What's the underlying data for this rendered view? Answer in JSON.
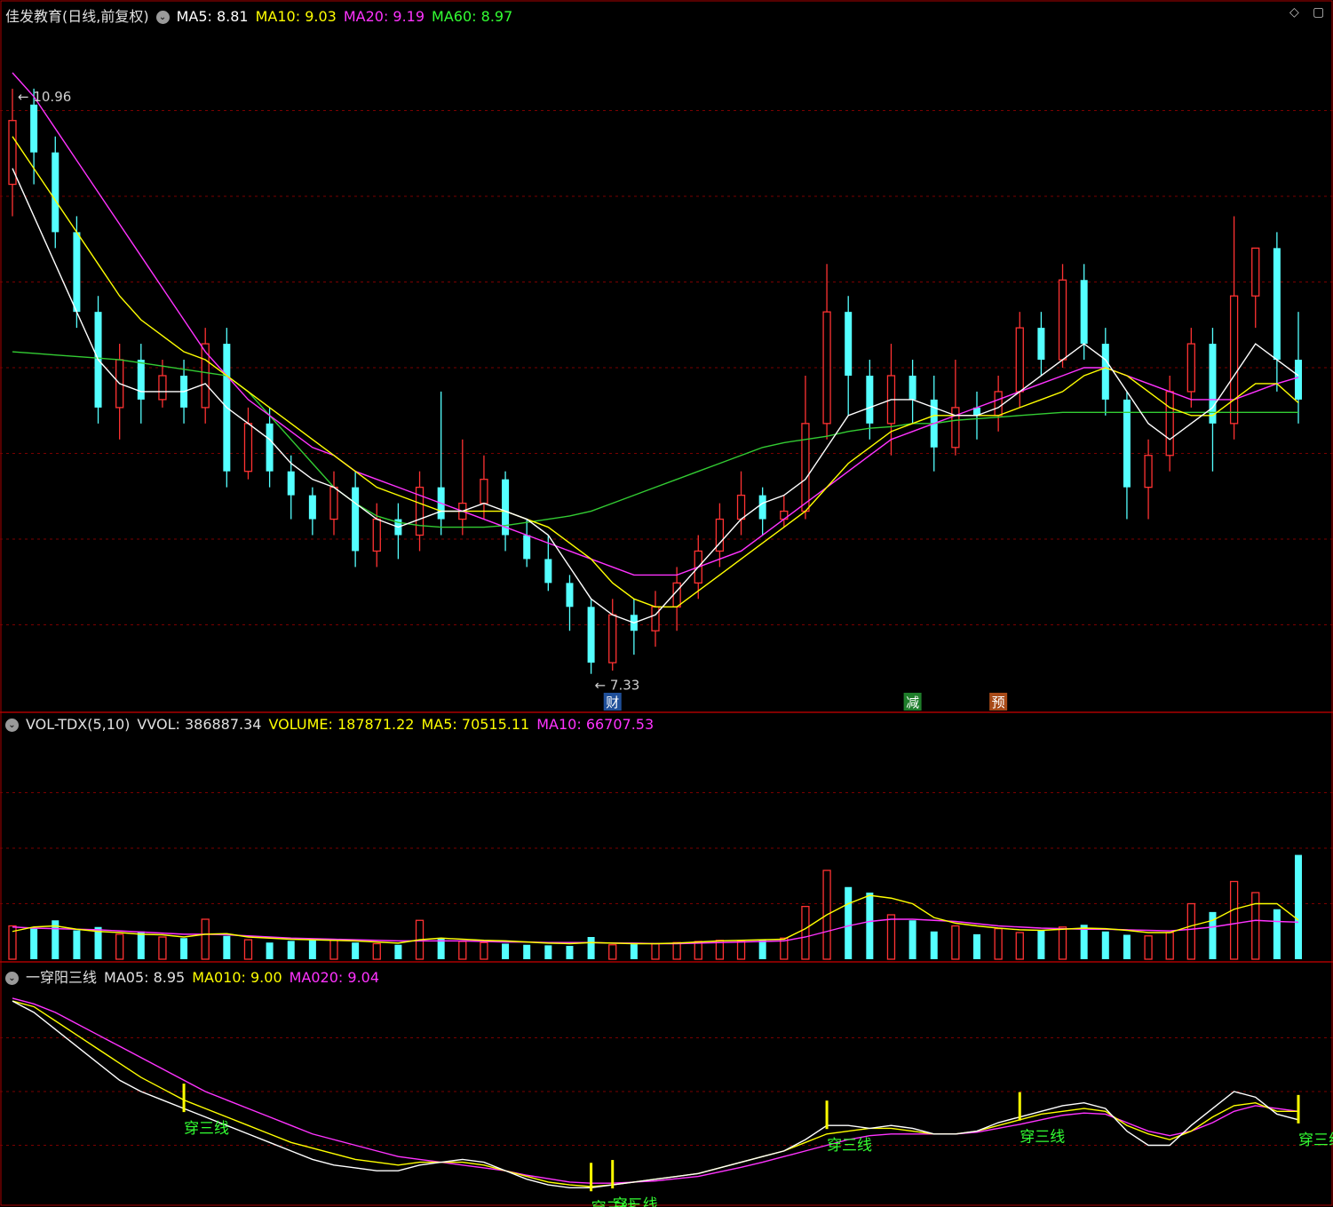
{
  "colors": {
    "up": "#ff3232",
    "down": "#54ffff",
    "ma_white": "#ffffff",
    "ma_yellow": "#ffff00",
    "ma_magenta": "#ff33ff",
    "ma_green": "#33cc33",
    "grid": "#7a0000",
    "frame": "#aa0000",
    "signal": "#ffff00",
    "signal_text": "#33ff33"
  },
  "price_panel": {
    "title": "佳发教育(日线,前复权)",
    "ma5": "MA5: 8.81",
    "ma10": "MA10: 9.03",
    "ma20": "MA20: 9.19",
    "ma60": "MA60: 8.97",
    "high_label": "10.96",
    "low_label": "7.33",
    "events": [
      "财",
      "减",
      "预"
    ]
  },
  "volume_panel": {
    "title": "VOL-TDX(5,10)",
    "vvol": "VVOL: 386887.34",
    "volume": "VOLUME: 187871.22",
    "ma5": "MA5: 70515.11",
    "ma10": "MA10: 66707.53"
  },
  "indicator_panel": {
    "title": "一穿阳三线",
    "ma05": "MA05: 8.95",
    "ma010": "MA010: 9.00",
    "ma020": "MA020: 9.04",
    "signal_label": "穿三线"
  },
  "icons": {
    "window_controls": [
      "diamond-icon",
      "restore-icon"
    ],
    "collapse": "chevron-down-icon"
  },
  "chart_data": {
    "type": "candlestick",
    "y_range": [
      7.1,
      11.4
    ],
    "candles": [
      [
        10.4,
        10.8,
        10.2,
        11.0
      ],
      [
        10.9,
        10.6,
        10.4,
        11.0
      ],
      [
        10.6,
        10.1,
        10.0,
        10.7
      ],
      [
        10.1,
        9.6,
        9.5,
        10.2
      ],
      [
        9.6,
        9.0,
        8.9,
        9.7
      ],
      [
        9.0,
        9.3,
        8.8,
        9.4
      ],
      [
        9.3,
        9.05,
        8.9,
        9.4
      ],
      [
        9.05,
        9.2,
        9.0,
        9.3
      ],
      [
        9.2,
        9.0,
        8.9,
        9.3
      ],
      [
        9.0,
        9.4,
        8.9,
        9.5
      ],
      [
        9.4,
        8.6,
        8.5,
        9.5
      ],
      [
        8.6,
        8.9,
        8.55,
        9.0
      ],
      [
        8.9,
        8.6,
        8.5,
        9.0
      ],
      [
        8.6,
        8.45,
        8.3,
        8.7
      ],
      [
        8.45,
        8.3,
        8.2,
        8.5
      ],
      [
        8.3,
        8.5,
        8.2,
        8.6
      ],
      [
        8.5,
        8.1,
        8.0,
        8.6
      ],
      [
        8.1,
        8.3,
        8.0,
        8.4
      ],
      [
        8.3,
        8.2,
        8.05,
        8.4
      ],
      [
        8.2,
        8.5,
        8.1,
        8.6
      ],
      [
        8.5,
        8.3,
        8.2,
        9.1
      ],
      [
        8.3,
        8.4,
        8.2,
        8.8
      ],
      [
        8.4,
        8.55,
        8.3,
        8.7
      ],
      [
        8.55,
        8.2,
        8.1,
        8.6
      ],
      [
        8.2,
        8.05,
        8.0,
        8.3
      ],
      [
        8.05,
        7.9,
        7.85,
        8.2
      ],
      [
        7.9,
        7.75,
        7.6,
        7.95
      ],
      [
        7.75,
        7.4,
        7.33,
        7.8
      ],
      [
        7.4,
        7.7,
        7.35,
        7.8
      ],
      [
        7.7,
        7.6,
        7.45,
        7.8
      ],
      [
        7.6,
        7.75,
        7.5,
        7.85
      ],
      [
        7.75,
        7.9,
        7.6,
        8.0
      ],
      [
        7.9,
        8.1,
        7.8,
        8.2
      ],
      [
        8.1,
        8.3,
        8.0,
        8.4
      ],
      [
        8.3,
        8.45,
        8.2,
        8.6
      ],
      [
        8.45,
        8.3,
        8.2,
        8.5
      ],
      [
        8.3,
        8.35,
        8.25,
        8.45
      ],
      [
        8.35,
        8.9,
        8.3,
        9.2
      ],
      [
        8.9,
        9.6,
        8.8,
        9.9
      ],
      [
        9.6,
        9.2,
        8.95,
        9.7
      ],
      [
        9.2,
        8.9,
        8.8,
        9.3
      ],
      [
        8.9,
        9.2,
        8.7,
        9.4
      ],
      [
        9.2,
        9.05,
        8.9,
        9.3
      ],
      [
        9.05,
        8.75,
        8.6,
        9.2
      ],
      [
        8.75,
        9.0,
        8.7,
        9.3
      ],
      [
        9.0,
        8.95,
        8.8,
        9.1
      ],
      [
        8.95,
        9.1,
        8.85,
        9.2
      ],
      [
        9.1,
        9.5,
        9.0,
        9.6
      ],
      [
        9.5,
        9.3,
        9.2,
        9.6
      ],
      [
        9.3,
        9.8,
        9.25,
        9.9
      ],
      [
        9.8,
        9.4,
        9.3,
        9.9
      ],
      [
        9.4,
        9.05,
        8.95,
        9.5
      ],
      [
        9.05,
        8.5,
        8.3,
        9.1
      ],
      [
        8.5,
        8.7,
        8.3,
        8.8
      ],
      [
        8.7,
        9.1,
        8.6,
        9.2
      ],
      [
        9.1,
        9.4,
        9.0,
        9.5
      ],
      [
        9.4,
        8.9,
        8.6,
        9.5
      ],
      [
        8.9,
        9.7,
        8.8,
        10.2
      ],
      [
        9.7,
        10.0,
        9.5,
        10.0
      ],
      [
        10.0,
        9.3,
        9.1,
        10.1
      ],
      [
        9.3,
        9.05,
        8.9,
        9.6
      ]
    ],
    "ma5": [
      10.5,
      10.2,
      9.9,
      9.6,
      9.3,
      9.15,
      9.1,
      9.1,
      9.1,
      9.15,
      9.0,
      8.9,
      8.8,
      8.65,
      8.55,
      8.5,
      8.4,
      8.3,
      8.25,
      8.3,
      8.35,
      8.35,
      8.4,
      8.35,
      8.3,
      8.2,
      8.0,
      7.8,
      7.7,
      7.65,
      7.7,
      7.85,
      8.0,
      8.15,
      8.3,
      8.4,
      8.45,
      8.55,
      8.75,
      8.95,
      9.0,
      9.05,
      9.05,
      9.0,
      8.95,
      8.95,
      9.0,
      9.1,
      9.2,
      9.3,
      9.4,
      9.3,
      9.1,
      8.9,
      8.8,
      8.9,
      9.0,
      9.2,
      9.4,
      9.3,
      9.2
    ],
    "ma10": [
      10.7,
      10.5,
      10.3,
      10.1,
      9.9,
      9.7,
      9.55,
      9.45,
      9.35,
      9.3,
      9.2,
      9.1,
      9.0,
      8.9,
      8.8,
      8.7,
      8.6,
      8.5,
      8.45,
      8.4,
      8.35,
      8.35,
      8.35,
      8.35,
      8.3,
      8.25,
      8.15,
      8.05,
      7.9,
      7.8,
      7.75,
      7.75,
      7.85,
      7.95,
      8.05,
      8.15,
      8.25,
      8.35,
      8.5,
      8.65,
      8.75,
      8.85,
      8.9,
      8.95,
      8.95,
      8.95,
      8.95,
      9.0,
      9.05,
      9.1,
      9.2,
      9.25,
      9.2,
      9.1,
      9.0,
      8.95,
      8.95,
      9.05,
      9.15,
      9.15,
      9.03
    ],
    "ma20": [
      11.1,
      10.95,
      10.75,
      10.55,
      10.35,
      10.15,
      9.95,
      9.75,
      9.55,
      9.35,
      9.2,
      9.05,
      8.95,
      8.85,
      8.75,
      8.7,
      8.6,
      8.55,
      8.5,
      8.45,
      8.4,
      8.35,
      8.3,
      8.25,
      8.2,
      8.15,
      8.1,
      8.05,
      8.0,
      7.95,
      7.95,
      7.95,
      8.0,
      8.05,
      8.1,
      8.2,
      8.3,
      8.4,
      8.5,
      8.6,
      8.7,
      8.8,
      8.85,
      8.9,
      8.95,
      9.0,
      9.05,
      9.1,
      9.15,
      9.2,
      9.25,
      9.25,
      9.2,
      9.15,
      9.1,
      9.05,
      9.05,
      9.05,
      9.1,
      9.15,
      9.19
    ],
    "ma60": [
      9.35,
      9.34,
      9.33,
      9.32,
      9.31,
      9.3,
      9.28,
      9.26,
      9.24,
      9.22,
      9.2,
      9.1,
      8.95,
      8.8,
      8.65,
      8.5,
      8.4,
      8.32,
      8.28,
      8.26,
      8.25,
      8.25,
      8.25,
      8.26,
      8.28,
      8.3,
      8.32,
      8.35,
      8.4,
      8.45,
      8.5,
      8.55,
      8.6,
      8.65,
      8.7,
      8.75,
      8.78,
      8.8,
      8.82,
      8.85,
      8.87,
      8.88,
      8.9,
      8.9,
      8.92,
      8.93,
      8.94,
      8.95,
      8.96,
      8.97,
      8.97,
      8.97,
      8.97,
      8.97,
      8.97,
      8.97,
      8.97,
      8.97,
      8.97,
      8.97,
      8.97
    ],
    "volume_range": [
      0,
      400000
    ],
    "volume": [
      60000,
      55000,
      70000,
      52000,
      58000,
      45000,
      50000,
      40000,
      38000,
      72000,
      42000,
      35000,
      30000,
      33000,
      36000,
      34000,
      30000,
      28000,
      26000,
      70000,
      38000,
      32000,
      30000,
      28000,
      26000,
      25000,
      24000,
      40000,
      26000,
      27000,
      28000,
      30000,
      32000,
      34000,
      33000,
      36000,
      38000,
      95000,
      160000,
      130000,
      120000,
      80000,
      70000,
      50000,
      60000,
      45000,
      55000,
      48000,
      52000,
      58000,
      62000,
      50000,
      44000,
      42000,
      48000,
      100000,
      85000,
      140000,
      120000,
      90000,
      187871
    ],
    "volume_ma5": [
      50000,
      58000,
      60000,
      54000,
      50000,
      48000,
      45000,
      44000,
      40000,
      45000,
      46000,
      40000,
      38000,
      36000,
      35000,
      34000,
      33000,
      31000,
      29000,
      35000,
      38000,
      36000,
      34000,
      33000,
      31000,
      29000,
      28000,
      30000,
      29000,
      28000,
      28000,
      29000,
      31000,
      33000,
      34000,
      35000,
      36000,
      55000,
      80000,
      100000,
      115000,
      110000,
      100000,
      75000,
      65000,
      60000,
      56000,
      53000,
      52000,
      54000,
      56000,
      55000,
      52000,
      48000,
      48000,
      60000,
      70000,
      90000,
      100000,
      100000,
      70515
    ],
    "volume_ma10": [
      58000,
      56000,
      55000,
      54000,
      53000,
      51000,
      49000,
      47000,
      45000,
      45000,
      44000,
      42000,
      40000,
      38000,
      37000,
      36000,
      35000,
      34000,
      33000,
      33000,
      33000,
      33000,
      32000,
      31000,
      31000,
      30000,
      30000,
      30000,
      29000,
      29000,
      28000,
      28000,
      29000,
      30000,
      31000,
      32000,
      33000,
      40000,
      50000,
      60000,
      68000,
      72000,
      72000,
      70000,
      68000,
      64000,
      60000,
      58000,
      56000,
      55000,
      54000,
      54000,
      53000,
      52000,
      51000,
      54000,
      58000,
      64000,
      70000,
      68000,
      66707
    ],
    "indicator": {
      "range": [
        7.3,
        11.1
      ],
      "ma05": [
        10.8,
        10.6,
        10.3,
        10.0,
        9.7,
        9.4,
        9.2,
        9.05,
        8.9,
        8.75,
        8.6,
        8.45,
        8.3,
        8.15,
        8.0,
        7.9,
        7.85,
        7.8,
        7.8,
        7.9,
        7.95,
        8.0,
        7.95,
        7.8,
        7.65,
        7.55,
        7.5,
        7.5,
        7.55,
        7.6,
        7.65,
        7.7,
        7.75,
        7.85,
        7.95,
        8.05,
        8.15,
        8.35,
        8.6,
        8.6,
        8.55,
        8.6,
        8.55,
        8.45,
        8.45,
        8.5,
        8.65,
        8.75,
        8.85,
        8.95,
        9.0,
        8.9,
        8.5,
        8.25,
        8.25,
        8.6,
        8.9,
        9.2,
        9.1,
        8.8,
        8.7
      ],
      "ma010": [
        10.8,
        10.7,
        10.45,
        10.2,
        9.95,
        9.7,
        9.45,
        9.25,
        9.05,
        8.9,
        8.75,
        8.6,
        8.45,
        8.3,
        8.2,
        8.1,
        8.0,
        7.95,
        7.9,
        7.95,
        7.95,
        7.95,
        7.9,
        7.8,
        7.7,
        7.6,
        7.55,
        7.52,
        7.55,
        7.6,
        7.65,
        7.7,
        7.75,
        7.85,
        7.95,
        8.05,
        8.15,
        8.3,
        8.45,
        8.5,
        8.55,
        8.55,
        8.5,
        8.45,
        8.45,
        8.5,
        8.6,
        8.7,
        8.8,
        8.85,
        8.9,
        8.85,
        8.6,
        8.45,
        8.35,
        8.5,
        8.75,
        8.95,
        9.0,
        8.85,
        8.85
      ],
      "ma020": [
        10.85,
        10.75,
        10.6,
        10.4,
        10.2,
        10.0,
        9.8,
        9.6,
        9.4,
        9.2,
        9.05,
        8.9,
        8.75,
        8.6,
        8.45,
        8.35,
        8.25,
        8.15,
        8.05,
        8.0,
        7.95,
        7.9,
        7.85,
        7.8,
        7.72,
        7.66,
        7.6,
        7.58,
        7.58,
        7.6,
        7.62,
        7.66,
        7.7,
        7.78,
        7.86,
        7.95,
        8.05,
        8.15,
        8.25,
        8.35,
        8.42,
        8.45,
        8.45,
        8.45,
        8.45,
        8.48,
        8.55,
        8.62,
        8.7,
        8.78,
        8.82,
        8.8,
        8.65,
        8.5,
        8.42,
        8.5,
        8.65,
        8.85,
        8.95,
        8.9,
        8.85
      ]
    },
    "signals": [
      8,
      27,
      28,
      38,
      47,
      60
    ]
  }
}
